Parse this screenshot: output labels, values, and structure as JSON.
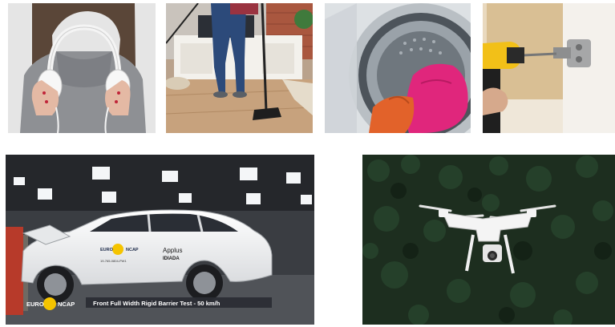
{
  "images": [
    {
      "name": "headphones-photo"
    },
    {
      "name": "vacuum-cleaning-photo"
    },
    {
      "name": "washing-machine-photo"
    },
    {
      "name": "cordless-drill-photo"
    },
    {
      "name": "crash-test-photo",
      "euro_ncap_top": "EURO",
      "euro_ncap_top2": "NCAP",
      "applus_line1": "Applus",
      "applus_line2": "IDIADA",
      "car_plate": "19-765-0804-PW1",
      "overlay_logo_1": "EURO",
      "overlay_logo_2": "NCAP",
      "caption": "Front Full Width Rigid Barrier Test - 50 km/h"
    },
    {
      "name": "drone-over-forest-photo"
    }
  ],
  "colors": {
    "background": "#ffffff",
    "ncap_yellow": "#f5c400",
    "caption_bar": "#2a2d33",
    "forest_dark": "#1d2e1f",
    "towel_pink": "#e0267c",
    "drill_yellow": "#f2c018"
  }
}
